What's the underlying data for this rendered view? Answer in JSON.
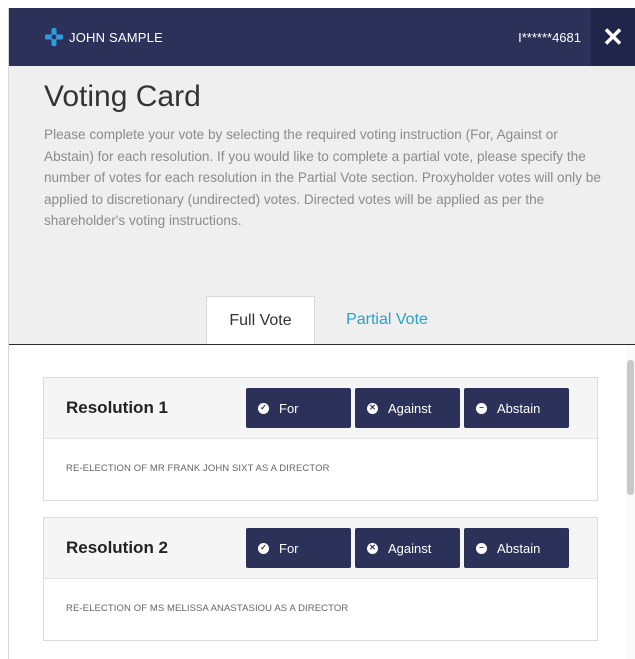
{
  "header": {
    "user_name": "JOHN SAMPLE",
    "account_id": "I******4681",
    "close_symbol": "✕",
    "colors": {
      "bar": "#2b3159",
      "icon": "#2f9be0"
    }
  },
  "voting": {
    "title": "Voting Card",
    "description": "Please complete your vote by selecting the required voting instruction (For, Against or Abstain) for each resolution. If you would like to complete a partial vote, please specify the number of votes for each resolution in the Partial Vote section. Proxyholder votes will only be applied to discretionary (undirected) votes. Directed votes will be applied as per the shareholder's voting instructions."
  },
  "tabs": [
    {
      "label": "Full Vote",
      "active": true
    },
    {
      "label": "Partial Vote",
      "active": false
    }
  ],
  "resolutions": [
    {
      "title": "Resolution 1",
      "description": "RE-ELECTION OF MR FRANK JOHN SIXT AS A DIRECTOR",
      "buttons": {
        "for": "For",
        "against": "Against",
        "abstain": "Abstain"
      }
    },
    {
      "title": "Resolution 2",
      "description": "RE-ELECTION OF MS MELISSA ANASTASIOU AS A DIRECTOR",
      "buttons": {
        "for": "For",
        "against": "Against",
        "abstain": "Abstain"
      }
    }
  ],
  "icons": {
    "for": "check-circle-icon",
    "against": "x-circle-icon",
    "abstain": "minus-circle-icon",
    "user": "plus-cross-icon",
    "close": "close-icon"
  }
}
